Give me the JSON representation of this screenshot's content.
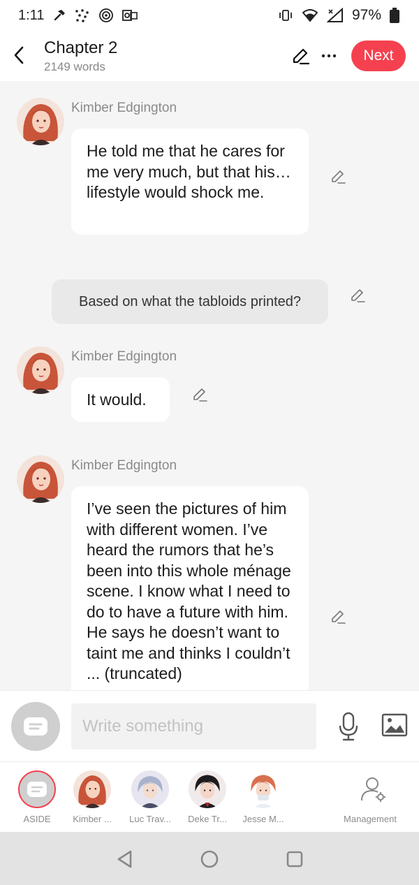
{
  "status_bar": {
    "time": "1:11",
    "battery": "97%"
  },
  "header": {
    "title": "Chapter 2",
    "word_count": "2149 words",
    "next_label": "Next"
  },
  "messages": [
    {
      "speaker": "Kimber Edgington",
      "text": "He told me that he cares for me very much, but that his…lifestyle would shock me."
    },
    {
      "aside": "Based on what the tabloids printed?"
    },
    {
      "speaker": "Kimber Edgington",
      "text": "It would."
    },
    {
      "speaker": "Kimber Edgington",
      "text": "I’ve seen the pictures of him with different women. I’ve heard the rumors that he’s been into this whole ménage scene. I know what I need to do to have a future with him. He says he doesn’t want to taint me and thinks I couldn’t ... (truncated)"
    }
  ],
  "composer": {
    "placeholder": "Write something"
  },
  "cast": [
    {
      "label": "ASIDE"
    },
    {
      "label": "Kimber ..."
    },
    {
      "label": "Luc Trav..."
    },
    {
      "label": "Deke Tr..."
    },
    {
      "label": "Jesse M..."
    },
    {
      "label": "Management"
    }
  ],
  "colors": {
    "accent": "#f5414f",
    "chat_background": "#f5f5f5",
    "bubble": "#ffffff",
    "aside_bubble": "#e9e9e9"
  }
}
